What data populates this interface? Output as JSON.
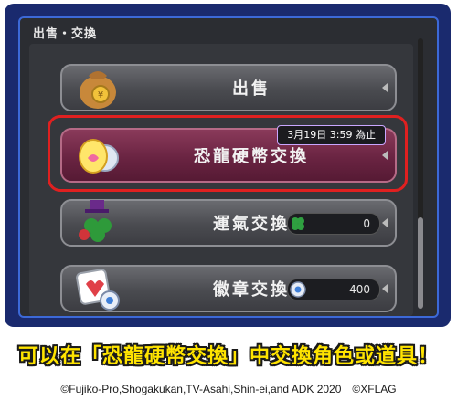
{
  "panel": {
    "header": "出售・交換"
  },
  "buttons": [
    {
      "label": "出售"
    },
    {
      "label": "恐龍硬幣交換",
      "badge": "3月19日 3:59 為止"
    },
    {
      "label": "運氣交換",
      "count": "0"
    },
    {
      "label": "徽章交換",
      "count": "400"
    }
  ],
  "caption": "可以在「恐龍硬幣交換」中交換角色或道具！",
  "copyright": "©Fujiko-Pro,Shogakukan,TV-Asahi,Shin-ei,and ADK 2020　©XFLAG",
  "colors": {
    "accent_border": "#3c69d8",
    "highlight": "#e02020",
    "caption": "#ffe400"
  }
}
